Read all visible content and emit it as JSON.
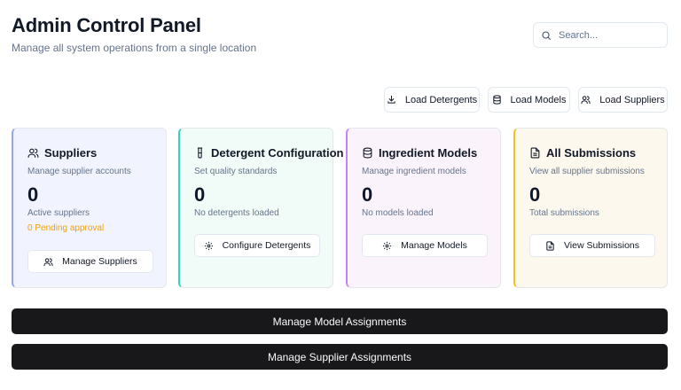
{
  "header": {
    "title": "Admin Control Panel",
    "subtitle": "Manage all system operations from a single location"
  },
  "search": {
    "placeholder": "Search...",
    "value": ""
  },
  "load_buttons": [
    {
      "label": "Load Detergents",
      "icon": "download-icon"
    },
    {
      "label": "Load Models",
      "icon": "database-icon"
    },
    {
      "label": "Load Suppliers",
      "icon": "users-icon"
    }
  ],
  "cards": [
    {
      "title": "Suppliers",
      "icon": "users-icon",
      "description": "Manage supplier accounts",
      "count": "0",
      "note": "Active suppliers",
      "pending": "0 Pending approval",
      "button": "Manage Suppliers",
      "accent": "#93a5f5",
      "background": "#f1f4fe"
    },
    {
      "title": "Detergent Configuration",
      "icon": "flask-icon",
      "description": "Set quality standards",
      "count": "0",
      "note": "No detergents loaded",
      "button": "Configure Detergents",
      "accent": "#2dd4bf",
      "background": "#f1fbf8"
    },
    {
      "title": "Ingredient Models",
      "icon": "database-icon",
      "description": "Manage ingredient models",
      "count": "0",
      "note": "No models loaded",
      "button": "Manage Models",
      "accent": "#c084fc",
      "background": "#faf3fc"
    },
    {
      "title": "All Submissions",
      "icon": "file-icon",
      "description": "View all supplier submissions",
      "count": "0",
      "note": "Total submissions",
      "button": "View Submissions",
      "accent": "#fbbf24",
      "background": "#fdf8ee"
    }
  ],
  "actions": {
    "model_assignments": "Manage Model Assignments",
    "supplier_assignments": "Manage Supplier Assignments"
  },
  "colors": {
    "pending": "#f59e0b",
    "dark_button": "#18181b"
  }
}
